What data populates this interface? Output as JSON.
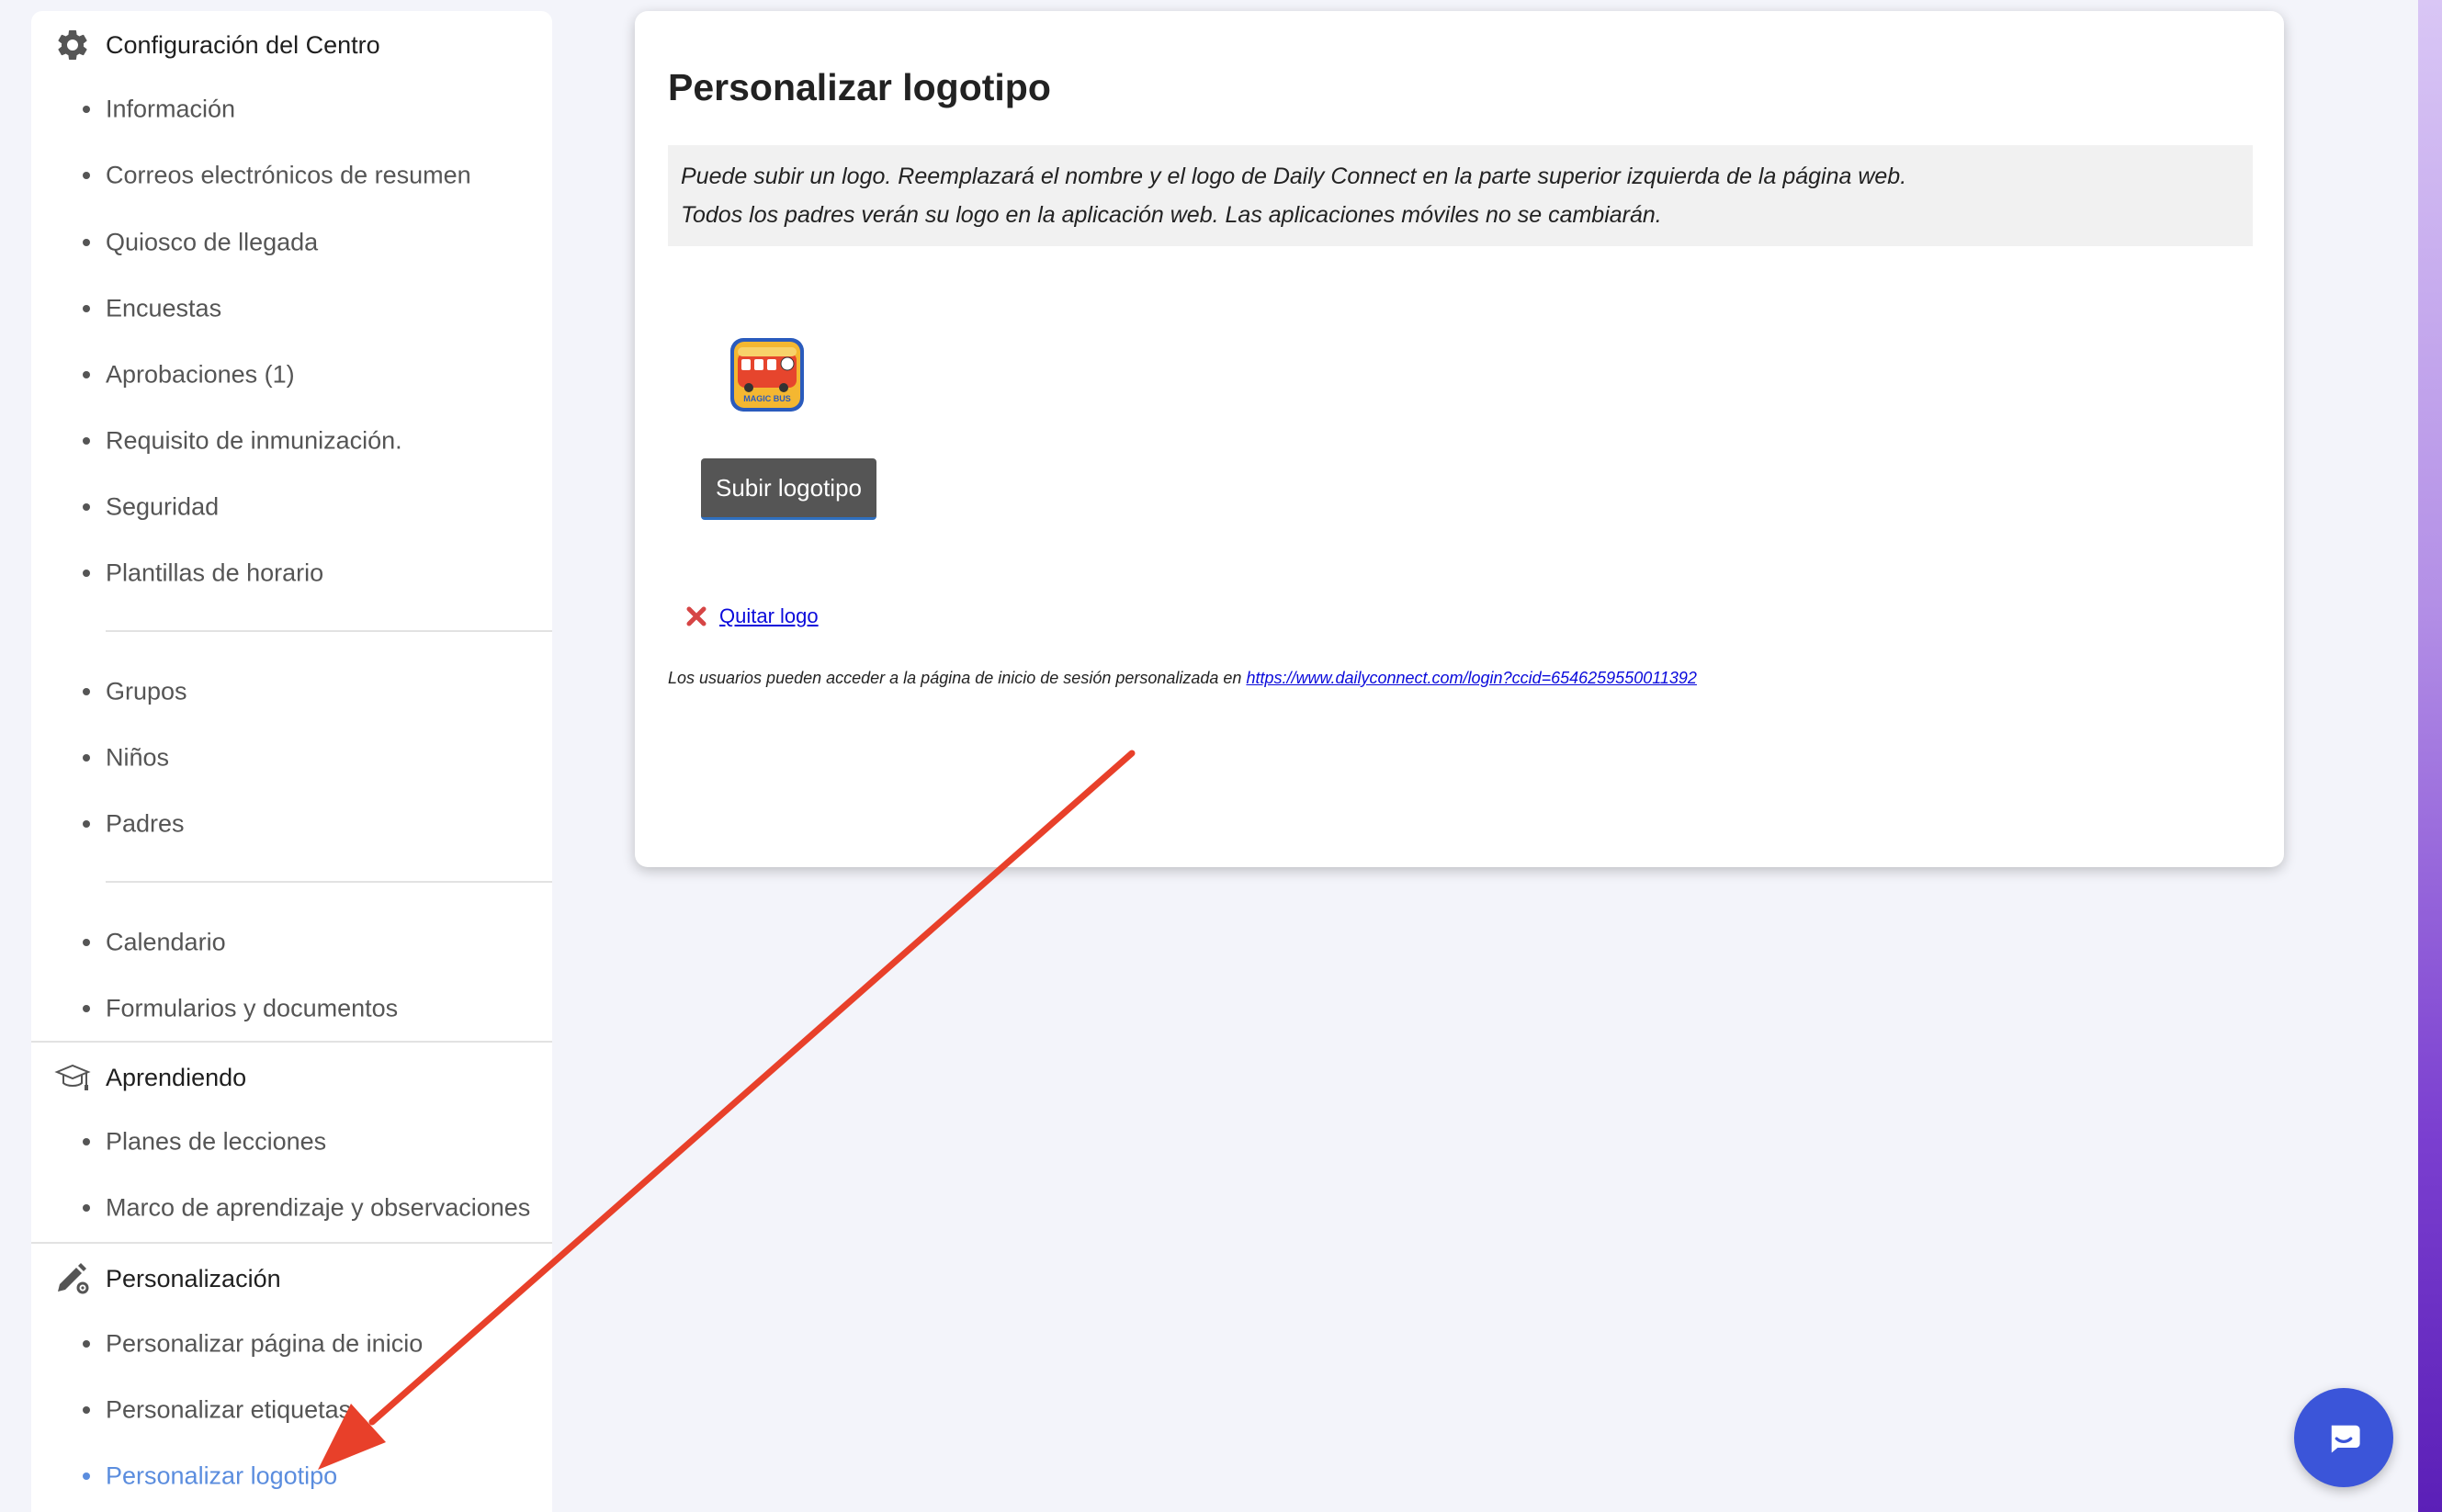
{
  "sidebar": {
    "sections": [
      {
        "title": "Configuración del Centro",
        "icon": "gear-icon"
      },
      {
        "title": "Aprendiendo",
        "icon": "graduation-cap-icon"
      },
      {
        "title": "Personalización",
        "icon": "pen-gear-icon"
      }
    ],
    "center_config_items": [
      "Información",
      "Correos electrónicos de resumen",
      "Quiosco de llegada",
      "Encuestas",
      "Aprobaciones (1)",
      "Requisito de inmunización.",
      "Seguridad",
      "Plantillas de horario",
      "Grupos",
      "Niños",
      "Padres",
      "Calendario",
      "Formularios y documentos"
    ],
    "learning_items": [
      "Planes de lecciones",
      "Marco de aprendizaje y observaciones"
    ],
    "customization_items": [
      "Personalizar página de inicio",
      "Personalizar etiquetas",
      "Personalizar logotipo"
    ],
    "active_item": "Personalizar logotipo",
    "active_color": "#5b8dde"
  },
  "main": {
    "title": "Personalizar logotipo",
    "notice_line1": "Puede subir un logo. Reemplazará el nombre y el logo de Daily Connect en la parte superior izquierda de la página web.",
    "notice_line2": "Todos los padres verán su logo en la aplicación web. Las aplicaciones móviles no se cambiarán.",
    "logo_text": "MAGIC BUS",
    "upload_button": "Subir logotipo",
    "remove_logo": "Quitar logo",
    "login_note_prefix": "Los usuarios pueden acceder a la página de inicio de sesión personalizada en ",
    "login_url": "https://www.dailyconnect.com/login?ccid=6546259550011392"
  },
  "chat": {
    "icon": "chat-icon",
    "color": "#3b55d9"
  },
  "annotation": {
    "color": "#e8402a"
  }
}
